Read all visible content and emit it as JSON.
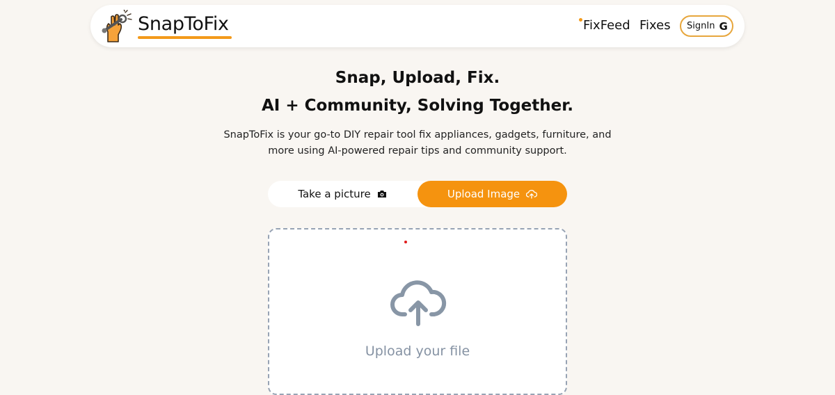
{
  "header": {
    "brand": "SnapToFix",
    "nav": {
      "fixfeed": "FixFeed",
      "fixes": "Fixes"
    },
    "signin_label": "SignIn",
    "signin_icon_glyph": "G"
  },
  "hero": {
    "headline_1": "Snap, Upload, Fix.",
    "headline_2": "AI + Community, Solving Together.",
    "subtitle": "SnapToFix is your go-to DIY repair tool fix appliances, gadgets, furniture, and more using AI-powered repair tips and community support."
  },
  "mode_toggle": {
    "take_picture": "Take a picture",
    "upload_image": "Upload Image",
    "active": "upload_image"
  },
  "dropzone": {
    "label": "Upload your file"
  },
  "colors": {
    "accent": "#f5930f",
    "background": "#f9f6f2",
    "dropzone_border": "#97a3b4"
  },
  "icons": {
    "logo": "hand-wrench-icon",
    "camera": "camera-icon",
    "upload": "cloud-upload-icon",
    "google": "google-icon"
  }
}
